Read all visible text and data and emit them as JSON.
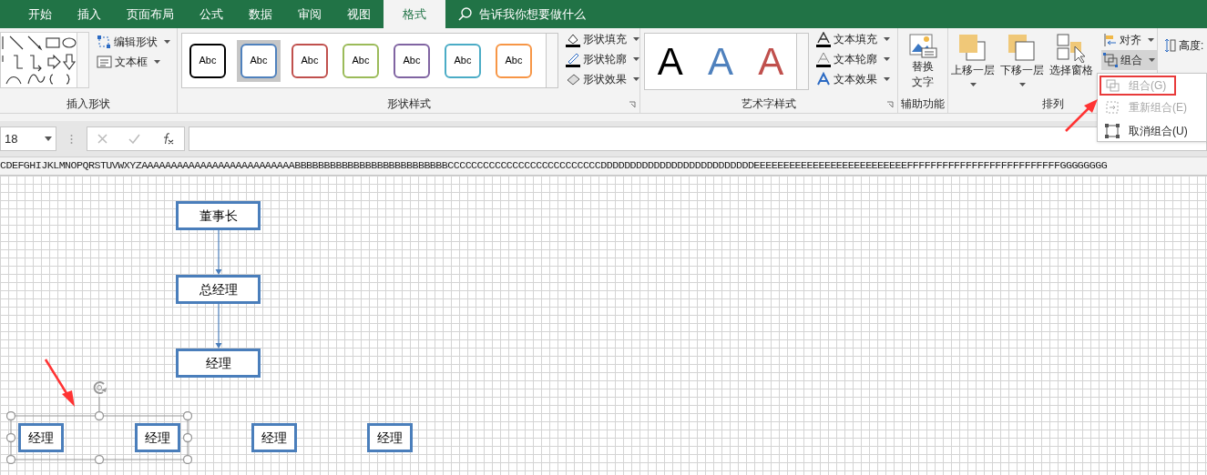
{
  "tabs": [
    {
      "label": "开始",
      "selected": false
    },
    {
      "label": "插入",
      "selected": false
    },
    {
      "label": "页面布局",
      "selected": false
    },
    {
      "label": "公式",
      "selected": false
    },
    {
      "label": "数据",
      "selected": false
    },
    {
      "label": "审阅",
      "selected": false
    },
    {
      "label": "视图",
      "selected": false
    },
    {
      "label": "格式",
      "selected": true
    }
  ],
  "tell_me": "告诉我你想要做什么",
  "insert_shapes": {
    "commands": [
      {
        "label": "编辑形状",
        "dropdown": true
      },
      {
        "label": "文本框",
        "dropdown": true
      }
    ],
    "label": "插入形状"
  },
  "shape_styles": {
    "styles": [
      {
        "label": "Abc",
        "color": "#000000",
        "selected": false
      },
      {
        "label": "Abc",
        "color": "#4f81bd",
        "selected": true
      },
      {
        "label": "Abc",
        "color": "#c0504d",
        "selected": false
      },
      {
        "label": "Abc",
        "color": "#9bbb59",
        "selected": false
      },
      {
        "label": "Abc",
        "color": "#8064a2",
        "selected": false
      },
      {
        "label": "Abc",
        "color": "#4bacc6",
        "selected": false
      },
      {
        "label": "Abc",
        "color": "#f79646",
        "selected": false
      }
    ],
    "commands": [
      {
        "label": "形状填充"
      },
      {
        "label": "形状轮廓"
      },
      {
        "label": "形状效果"
      }
    ],
    "label": "形状样式"
  },
  "wordart": {
    "samples": [
      {
        "label": "A",
        "color": "#000000"
      },
      {
        "label": "A",
        "color": "#4f81bd"
      },
      {
        "label": "A",
        "color": "#c0504d"
      }
    ],
    "commands": [
      {
        "label": "文本填充"
      },
      {
        "label": "文本轮廓"
      },
      {
        "label": "文本效果"
      }
    ],
    "label": "艺术字样式"
  },
  "accessibility": {
    "button": [
      "替换",
      "文字"
    ],
    "label": "辅助功能"
  },
  "arrange": {
    "buttons": [
      {
        "label": "上移一层",
        "dropdown": true
      },
      {
        "label": "下移一层",
        "dropdown": true
      },
      {
        "label": "选择窗格",
        "dropdown": false
      }
    ],
    "small": [
      {
        "label": "对齐",
        "open": false
      },
      {
        "label": "组合",
        "open": true
      }
    ],
    "label": "排列"
  },
  "size": {
    "label": "高度:"
  },
  "group_menu": [
    {
      "label": "组合(G)",
      "disabled": true,
      "highlighted": true
    },
    {
      "label": "重新组合(E)",
      "disabled": true,
      "highlighted": false
    },
    {
      "label": "取消组合(U)",
      "disabled": false,
      "highlighted": false
    }
  ],
  "name_box": "18",
  "column_header": "CDEFGHIJKLMNOPQRSTUVWXYZAAAAAAAAAAAAAAAAAAAAAAAAAABBBBBBBBBBBBBBBBBBBBBBBBBBCCCCCCCCCCCCCCCCCCCCCCCCCCDDDDDDDDDDDDDDDDDDDDDDDDDDEEEEEEEEEEEEEEEEEEEEEEEEEEFFFFFFFFFFFFFFFFFFFFFFFFFFGGGGGGGG",
  "org_chart": {
    "chain": [
      "董事长",
      "总经理",
      "经理"
    ],
    "selected_group": {
      "selected": true,
      "nodes": [
        "经理",
        "经理"
      ]
    },
    "loose_nodes": [
      "经理",
      "经理"
    ]
  }
}
